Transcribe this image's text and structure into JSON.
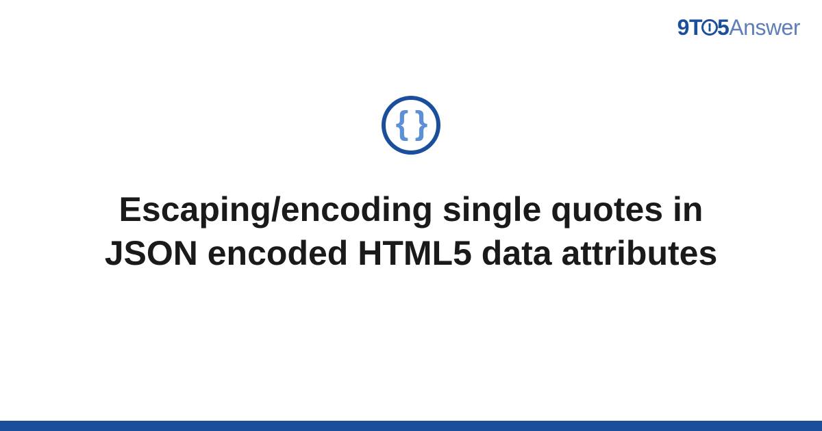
{
  "brand": {
    "prefix": "9T",
    "suffix": "5",
    "word": "Answer"
  },
  "topic": {
    "icon_glyph": "{ }",
    "icon_name": "json-braces"
  },
  "title": "Escaping/encoding single quotes in JSON encoded HTML5 data attributes",
  "colors": {
    "brand_primary": "#1b4f9c",
    "brand_secondary": "#5c7fb8",
    "icon_inner": "#5c8fd6",
    "text": "#1a1a1a",
    "footer": "#1b4f9c"
  }
}
